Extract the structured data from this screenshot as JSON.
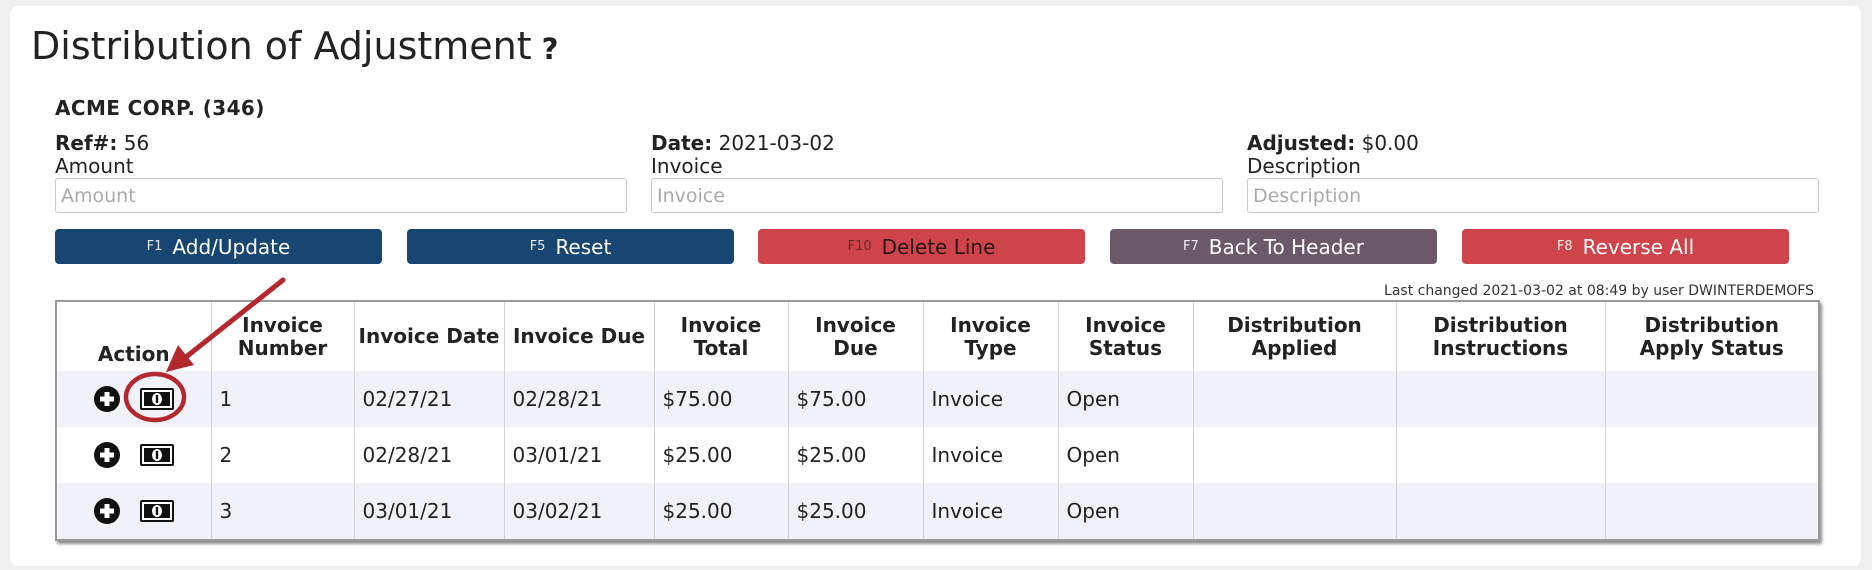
{
  "page": {
    "title": "Distribution of Adjustment",
    "help": "?"
  },
  "company": "ACME CORP. (346)",
  "info": {
    "ref_label": "Ref#:",
    "ref_value": "56",
    "date_label": "Date:",
    "date_value": "2021-03-02",
    "adjusted_label": "Adjusted:",
    "adjusted_value": "$0.00"
  },
  "fields": {
    "amount": {
      "label": "Amount",
      "placeholder": "Amount",
      "value": ""
    },
    "invoice": {
      "label": "Invoice",
      "placeholder": "Invoice",
      "value": ""
    },
    "description": {
      "label": "Description",
      "placeholder": "Description",
      "value": ""
    }
  },
  "buttons": [
    {
      "key": "F1",
      "label": "Add/Update",
      "color": "#174672"
    },
    {
      "key": "F5",
      "label": "Reset",
      "color": "#174672"
    },
    {
      "key": "F10",
      "label": "Delete Line",
      "color": "#cf434b"
    },
    {
      "key": "F7",
      "label": "Back To Header",
      "color": "#6b5868"
    },
    {
      "key": "F8",
      "label": "Reverse All",
      "color": "#cf434b"
    }
  ],
  "last_changed": "Last changed 2021-03-02 at 08:49 by user DWINTERDEMOFS",
  "table": {
    "headers": [
      "Action",
      "Invoice Number",
      "Invoice Date",
      "Invoice Due",
      "Invoice Total",
      "Invoice Due",
      "Invoice Type",
      "Invoice Status",
      "Distribution Applied",
      "Distribution Instructions",
      "Distribution Apply Status"
    ],
    "rows": [
      {
        "number": "1",
        "date": "02/27/21",
        "due_date": "02/28/21",
        "total": "$75.00",
        "due": "$75.00",
        "type": "Invoice",
        "status": "Open",
        "applied": "",
        "instructions": "",
        "apply_status": ""
      },
      {
        "number": "2",
        "date": "02/28/21",
        "due_date": "03/01/21",
        "total": "$25.00",
        "due": "$25.00",
        "type": "Invoice",
        "status": "Open",
        "applied": "",
        "instructions": "",
        "apply_status": ""
      },
      {
        "number": "3",
        "date": "03/01/21",
        "due_date": "03/02/21",
        "total": "$25.00",
        "due": "$25.00",
        "type": "Invoice",
        "status": "Open",
        "applied": "",
        "instructions": "",
        "apply_status": ""
      }
    ]
  },
  "icons": {
    "add": "plus-circle-icon",
    "distribute": "money-bill-icon",
    "annotation": "red-arrow-annotation"
  },
  "colors": {
    "primary_button": "#174672",
    "danger_button": "#cf434b",
    "neutral_button": "#6b5868",
    "annotation": "#b3282d"
  }
}
